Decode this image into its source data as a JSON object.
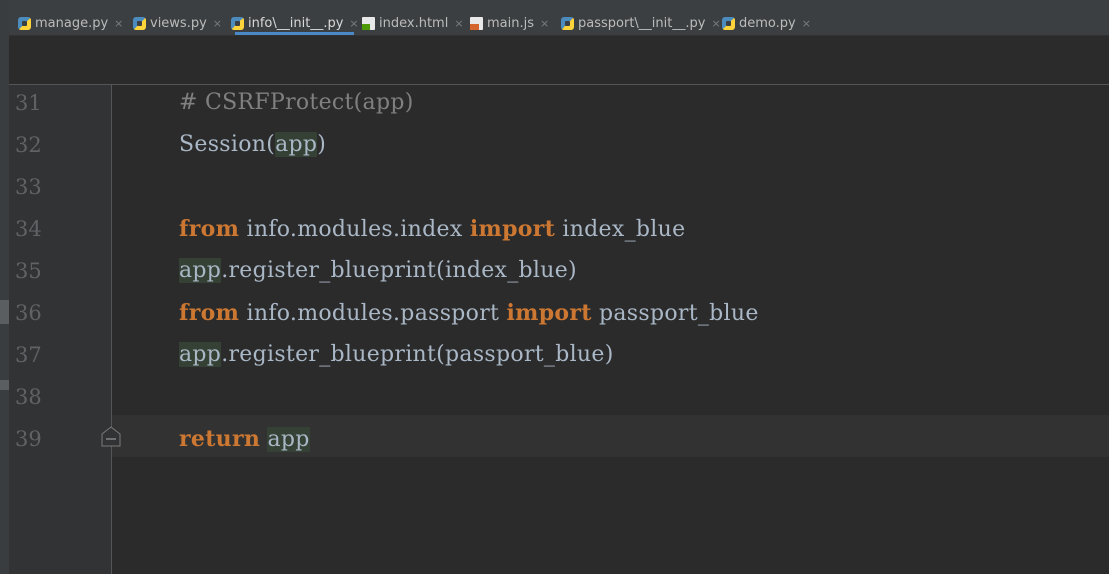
{
  "tabs": [
    {
      "label": "manage.py",
      "type": "py",
      "active": false
    },
    {
      "label": "views.py",
      "type": "py",
      "active": false
    },
    {
      "label": "info\\__init__.py",
      "type": "py",
      "active": true
    },
    {
      "label": "index.html",
      "type": "html",
      "active": false
    },
    {
      "label": "main.js",
      "type": "js",
      "active": false
    },
    {
      "label": "passport\\__init__.py",
      "type": "py",
      "active": false
    },
    {
      "label": "demo.py",
      "type": "py",
      "active": false
    }
  ],
  "close_glyph": "×",
  "editor": {
    "lines": [
      {
        "number": "31",
        "tokens": [
          {
            "text": "# CSRFProtect(app)",
            "kind": "comment"
          }
        ]
      },
      {
        "number": "32",
        "tokens": [
          {
            "text": "Session(",
            "kind": "plain"
          },
          {
            "text": "app",
            "kind": "highlight"
          },
          {
            "text": ")",
            "kind": "plain"
          }
        ]
      },
      {
        "number": "33",
        "tokens": []
      },
      {
        "number": "34",
        "tokens": [
          {
            "text": "from",
            "kind": "keyword"
          },
          {
            "text": " info.modules.index ",
            "kind": "plain"
          },
          {
            "text": "import",
            "kind": "keyword"
          },
          {
            "text": " index_blue",
            "kind": "plain"
          }
        ]
      },
      {
        "number": "35",
        "tokens": [
          {
            "text": "app",
            "kind": "highlight"
          },
          {
            "text": ".register_blueprint(index_blue)",
            "kind": "plain"
          }
        ]
      },
      {
        "number": "36",
        "tokens": [
          {
            "text": "from",
            "kind": "keyword"
          },
          {
            "text": " info.modules.passport ",
            "kind": "plain"
          },
          {
            "text": "import",
            "kind": "keyword"
          },
          {
            "text": " passport_blue",
            "kind": "plain"
          }
        ]
      },
      {
        "number": "37",
        "tokens": [
          {
            "text": "app",
            "kind": "highlight"
          },
          {
            "text": ".register_blueprint(passport_blue)",
            "kind": "plain"
          }
        ]
      },
      {
        "number": "38",
        "tokens": []
      },
      {
        "number": "39",
        "tokens": [
          {
            "text": "return",
            "kind": "keyword"
          },
          {
            "text": " ",
            "kind": "plain"
          },
          {
            "text": "app",
            "kind": "highlight"
          }
        ]
      }
    ],
    "current_line": "39"
  },
  "colors": {
    "background": "#2b2b2b",
    "gutter": "#313335",
    "keyword": "#cc7832",
    "comment": "#808080",
    "text": "#a9b7c6",
    "line_number": "#606366",
    "highlight_bg": "#344134",
    "active_tab_underline": "#4a88c7"
  }
}
